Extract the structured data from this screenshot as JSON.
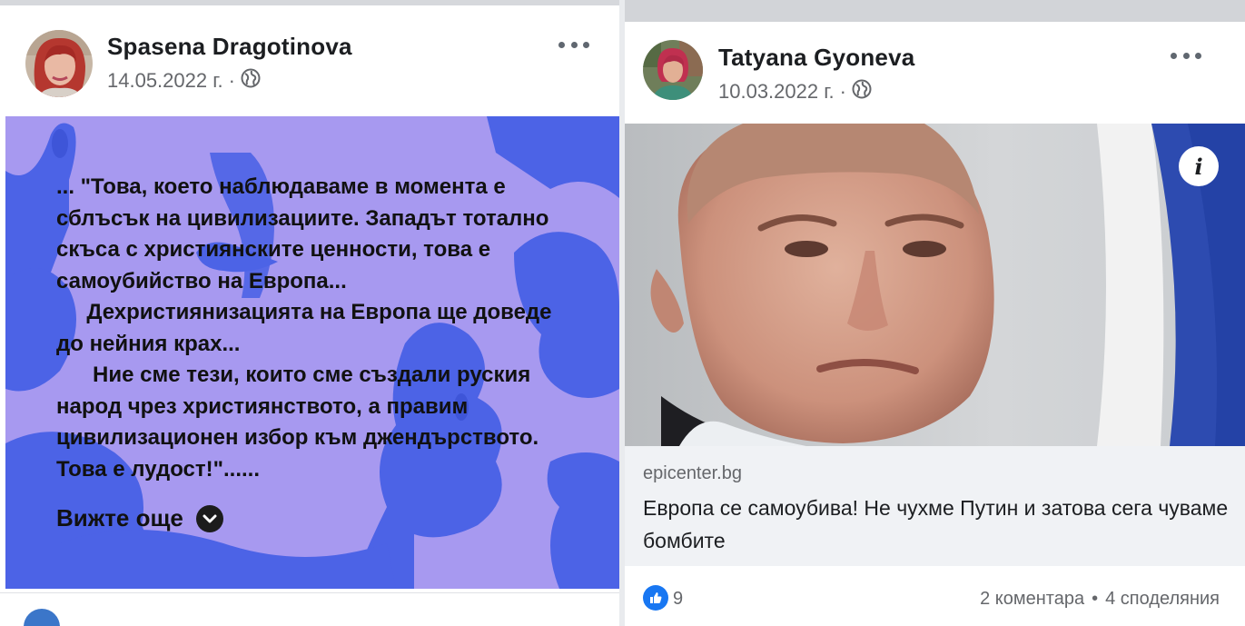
{
  "left_post": {
    "author": "Spasena Dragotinova",
    "date": "14.05.2022 г.",
    "separator": "·",
    "audience_icon": "globe-icon",
    "menu_icon": "more-horizontal-icon",
    "quote": "... \"Това, което наблюдаваме в момента е сблъсък на цивилизациите. Западът тотално скъса с християнските ценности, това е самоубийство на Европа...\n     Дехристиянизацията на Европа ще доведе до нейния крах...\n      Ние сме тези, които сме създали руския народ чрез християнството, а правим цивилизационен избор към джендърството. Това е лудост!\"......",
    "see_more": "Вижте още",
    "see_more_icon": "chevron-down-icon",
    "card_color": "#a799f0",
    "shape_color": "#4c63e6"
  },
  "right_post": {
    "author": "Tatyana Gyoneva",
    "date": "10.03.2022 г.",
    "separator": "·",
    "audience_icon": "globe-icon",
    "menu_icon": "more-horizontal-icon",
    "info_icon": "i",
    "link_domain": "epicenter.bg",
    "link_title": "Европа се самоубива! Не чухме Путин и затова сега чуваме бомбите",
    "reaction_icon": "thumbs-up-icon",
    "reaction_count": "9",
    "comments": "2 коментара",
    "stats_separator": "•",
    "shares": "4 споделяния",
    "accent_color": "#1877f2"
  }
}
